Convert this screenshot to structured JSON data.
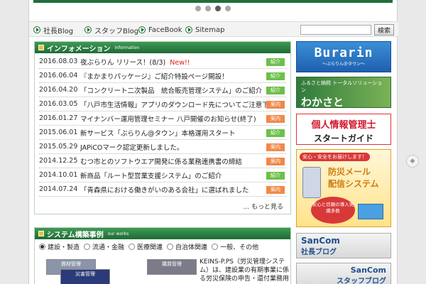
{
  "colors": {
    "brand_green": "#1e6b36",
    "badge_green": "#6cc04a",
    "badge_orange": "#f0894a",
    "new_red": "#e02020"
  },
  "slider": {
    "dot_count": 4,
    "active_index": 2
  },
  "nav": {
    "items": [
      {
        "label": "社長Blog",
        "icon": "play-circle-icon"
      },
      {
        "label": "スタッフBlog",
        "icon": "play-circle-icon"
      },
      {
        "label": "FaceBook",
        "icon": "play-circle-icon"
      },
      {
        "label": "Sitemap",
        "icon": "play-circle-icon"
      }
    ],
    "search_value": "",
    "search_button": "検索"
  },
  "info": {
    "title": "インフォメーション",
    "subtitle": "information",
    "news": [
      {
        "date": "2016.08.03",
        "title": "夜ぶらりん リリース！(8/3)",
        "new_label": "New!!",
        "badge": "紹介",
        "badge_type": "green"
      },
      {
        "date": "2016.06.04",
        "title": "『まかまりパッケージ』ご紹介特設ページ開設！",
        "new_label": "",
        "badge": "紹介",
        "badge_type": "green"
      },
      {
        "date": "2016.04.20",
        "title": "「コンクリート二次製品　統合販売管理システム」のご紹介",
        "new_label": "",
        "badge": "紹介",
        "badge_type": "green"
      },
      {
        "date": "2016.03.05",
        "title": "「八戸市生活情報」アプリのダウンロード先についてご注意下さい",
        "new_label": "",
        "badge": "案内",
        "badge_type": "orange"
      },
      {
        "date": "2016.01.27",
        "title": "マイナンバー運用管理セミナー 八戸開催のお知らせ(終了)",
        "new_label": "",
        "badge": "案内",
        "badge_type": "orange"
      },
      {
        "date": "2015.06.01",
        "title": "新サービス「ぶらりん@タウン」本格運用スタート",
        "new_label": "",
        "badge": "紹介",
        "badge_type": "green"
      },
      {
        "date": "2015.05.29",
        "title": "JAPiCOマーク認定更新しました。",
        "new_label": "",
        "badge": "案内",
        "badge_type": "orange"
      },
      {
        "date": "2014.12.25",
        "title": "むつ市とのソフトウエア開発に係る業務連携書の締結",
        "new_label": "",
        "badge": "案内",
        "badge_type": "orange"
      },
      {
        "date": "2014.10.01",
        "title": "新商品「ルート型営業支援システム」のご紹介",
        "new_label": "",
        "badge": "紹介",
        "badge_type": "green"
      },
      {
        "date": "2014.07.24",
        "title": "「青森県における働きがいのある会社」に選ばれました",
        "new_label": "",
        "badge": "案内",
        "badge_type": "orange"
      }
    ],
    "more": "... もっと見る"
  },
  "system": {
    "title": "システム構築事例",
    "subtitle": "our works",
    "categories": [
      {
        "label": "建設・製造",
        "selected": true
      },
      {
        "label": "流通・金融",
        "selected": false
      },
      {
        "label": "医療関連",
        "selected": false
      },
      {
        "label": "自治体関連",
        "selected": false
      },
      {
        "label": "一般、その他",
        "selected": false
      }
    ],
    "thumbs": [
      {
        "label": "災害管理"
      },
      {
        "label": "資材管理"
      },
      {
        "label": "購買管理"
      }
    ],
    "description": "KEINS-P.PS（労災管理システム）は、建設業の有期事業に係る労災保険の申告・還付業務用のソリューションです。"
  },
  "banners": {
    "burarin": {
      "big": "Burarin",
      "small": "〜ぶらりん＠タウン〜"
    },
    "wakasato": {
      "small": "ふるさと納税 トータルソリューション",
      "big": "わかさと"
    },
    "guide": {
      "line1": "個人情報管理士",
      "line2": "スタートガイド"
    },
    "mail": {
      "pill": "安心・安全をお届けします！",
      "line1": "防災メール",
      "line2": "配信システム",
      "circle": "安心と信頼の導入実績多数"
    },
    "blog1": {
      "line1": "SanCom",
      "line2": "社長ブログ"
    },
    "blog2": {
      "line1": "SanCom",
      "line2": "スタッフブログ"
    }
  }
}
